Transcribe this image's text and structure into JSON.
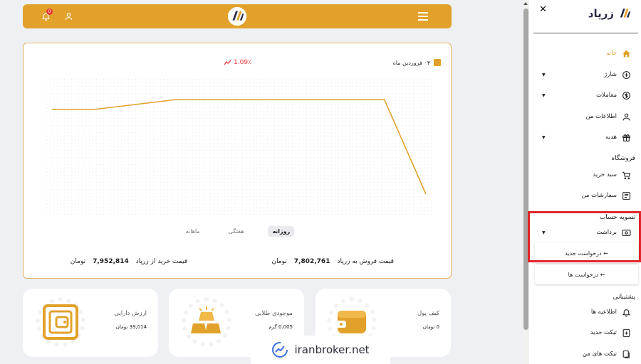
{
  "header": {
    "notification_count": "0",
    "colors": {
      "brand": "#e2a12b",
      "alert": "#e53935"
    }
  },
  "chart_data": {
    "type": "line",
    "legend_label": "۰۴ فروردین ماه",
    "change": "1.09٪",
    "x": [
      1,
      2,
      3,
      4,
      5,
      6,
      7,
      8,
      9,
      10
    ],
    "values": [
      100.0,
      100.0,
      100.1,
      100.2,
      100.2,
      100.2,
      100.2,
      100.2,
      100.2,
      98.3
    ],
    "ylim": [
      98.0,
      100.5
    ],
    "grid": false
  },
  "chart": {
    "periods": [
      "روزانه",
      "هفتگی",
      "ماهانه"
    ],
    "active_period": "روزانه",
    "sell_label": "قیمت فروش به زرپاد",
    "sell_value": "7,802,761",
    "sell_unit": "تومان",
    "buy_label": "قیمت خرید از زرپاد",
    "buy_value": "7,952,814",
    "buy_unit": "تومان"
  },
  "cards": {
    "wallet": {
      "title": "کیف پول",
      "value": "0 تومان"
    },
    "gold": {
      "title": "موجودی طلایی",
      "value": "0.005 گرم"
    },
    "assets": {
      "title": "ارزش دارایی",
      "value": "39,014 تومان"
    }
  },
  "watermark": "iranbroker.net",
  "sidebar": {
    "brand": "زرپاد",
    "items": {
      "home": "خانه",
      "charge": "شارژ",
      "transactions": "معاملات",
      "my_info": "اطلاعات من",
      "gift": "هدیه",
      "cart": "سبد خرید",
      "orders": "سفارشات من",
      "withdraw": "برداشت",
      "notifications": "اطلاعیه ها",
      "new_ticket": "تیکت جدید",
      "my_tickets": "تیکت های من"
    },
    "sections": {
      "store": "فروشگاه",
      "settlement": "تسویه حساب",
      "support": "پشتیبانی"
    },
    "sub_items": {
      "new_request": "← درخواست جدید",
      "requests": "← درخواست ها"
    }
  }
}
